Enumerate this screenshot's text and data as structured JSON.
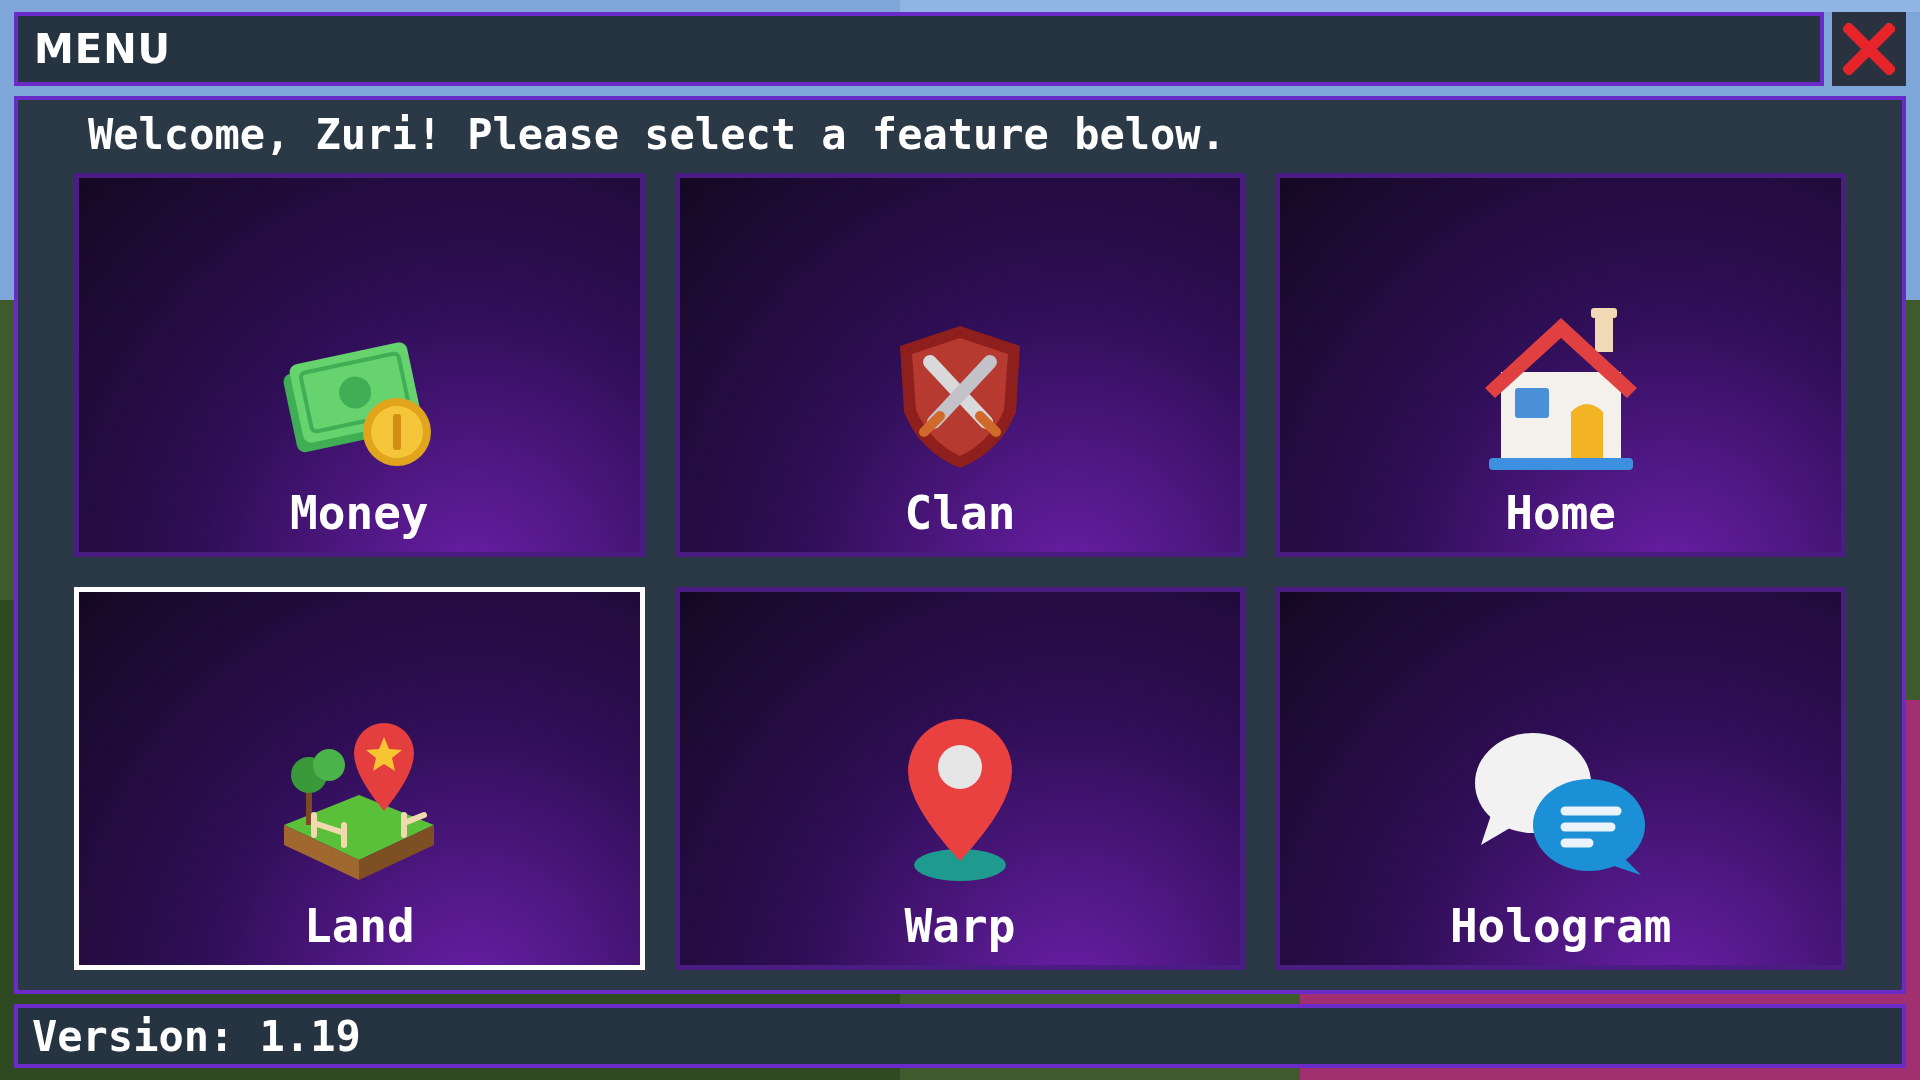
{
  "window": {
    "title": "MENU"
  },
  "welcome": "Welcome, Zuri! Please select a feature below.",
  "features": [
    {
      "label": "Money",
      "selected": false
    },
    {
      "label": "Clan",
      "selected": false
    },
    {
      "label": "Home",
      "selected": false
    },
    {
      "label": "Land",
      "selected": true
    },
    {
      "label": "Warp",
      "selected": false
    },
    {
      "label": "Hologram",
      "selected": false
    }
  ],
  "footer": "Version: 1.19"
}
